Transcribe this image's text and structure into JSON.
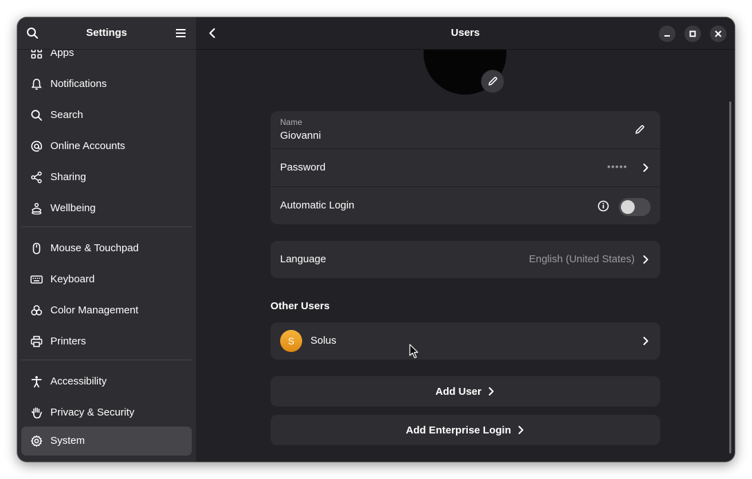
{
  "sidebar": {
    "title": "Settings",
    "items": [
      {
        "label": "Apps",
        "icon": "apps-icon"
      },
      {
        "label": "Notifications",
        "icon": "bell-icon"
      },
      {
        "label": "Search",
        "icon": "search-icon"
      },
      {
        "label": "Online Accounts",
        "icon": "at-icon"
      },
      {
        "label": "Sharing",
        "icon": "share-icon"
      },
      {
        "label": "Wellbeing",
        "icon": "wellbeing-icon"
      },
      {
        "label": "Mouse & Touchpad",
        "icon": "mouse-icon"
      },
      {
        "label": "Keyboard",
        "icon": "keyboard-icon"
      },
      {
        "label": "Color Management",
        "icon": "color-icon"
      },
      {
        "label": "Printers",
        "icon": "printer-icon"
      },
      {
        "label": "Accessibility",
        "icon": "accessibility-icon"
      },
      {
        "label": "Privacy & Security",
        "icon": "hand-icon"
      },
      {
        "label": "System",
        "icon": "gear-icon"
      }
    ],
    "selected": "System"
  },
  "header": {
    "title": "Users"
  },
  "account": {
    "name_label": "Name",
    "name_value": "Giovanni",
    "password_label": "Password",
    "password_value": "•••••",
    "autologin_label": "Automatic Login",
    "autologin_enabled": false
  },
  "language": {
    "label": "Language",
    "value": "English (United States)"
  },
  "other_users": {
    "title": "Other Users",
    "users": [
      {
        "initial": "S",
        "name": "Solus"
      }
    ]
  },
  "actions": {
    "add_user": "Add User",
    "add_enterprise": "Add Enterprise Login"
  },
  "colors": {
    "window_bg": "#222226",
    "sidebar_bg": "#2e2e32",
    "card_bg": "#2e2e32",
    "selected_bg": "#46464a",
    "avatar_orange": "#f0a02a"
  }
}
